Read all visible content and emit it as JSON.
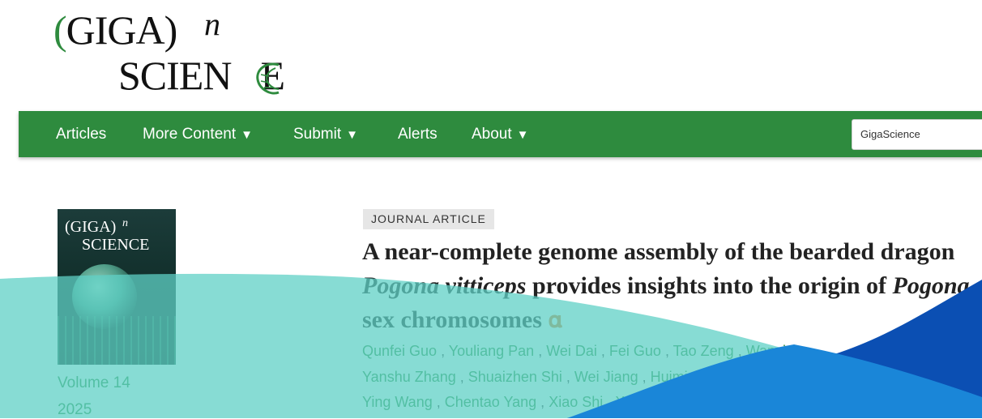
{
  "logo": {
    "line1_left": "(",
    "line1_text": "GIGA",
    "line1_right": ")",
    "superscript": "n",
    "line2": "SCIEN",
    "line2_end": "E"
  },
  "nav": {
    "items": [
      {
        "label": "Articles",
        "has_dropdown": false
      },
      {
        "label": "More Content",
        "has_dropdown": true
      },
      {
        "label": "Submit",
        "has_dropdown": true
      },
      {
        "label": "Alerts",
        "has_dropdown": false
      },
      {
        "label": "About",
        "has_dropdown": true
      }
    ],
    "caret": "▼",
    "search_value": "GigaScience"
  },
  "cover": {
    "line1": "(GIGA)",
    "sup": "n",
    "line2": "SCIENCE"
  },
  "issue": {
    "volume": "Volume 14",
    "year": "2025"
  },
  "article": {
    "type_badge": "JOURNAL ARTICLE",
    "title_part1": "A near-complete genome assembly of the bearded dragon ",
    "title_italic1": "Pogona vitticeps",
    "title_part2": " provides insights into the origin of ",
    "title_italic2": "Pogona",
    "title_part3": " sex chromosomes",
    "authors_line1": [
      "Qunfei Guo",
      "Youliang Pan",
      "Wei Dai",
      "Fei Guo",
      "Tao Zeng",
      "Wanyi C"
    ],
    "authors_line2": [
      "Yanshu Zhang",
      "Shuaizhen Shi",
      "Wei Jiang",
      "Huimin C"
    ],
    "authors_line3": [
      "Ying Wang",
      "Chentao Yang",
      "Xiao Shi",
      "Xu Y"
    ]
  },
  "colors": {
    "brand_green": "#2e8b3e",
    "overlay_teal": "#5fd0c6",
    "overlay_blue_dark": "#0b4fb3",
    "overlay_blue_light": "#1a86d8",
    "oa_orange": "#e07a2b"
  }
}
